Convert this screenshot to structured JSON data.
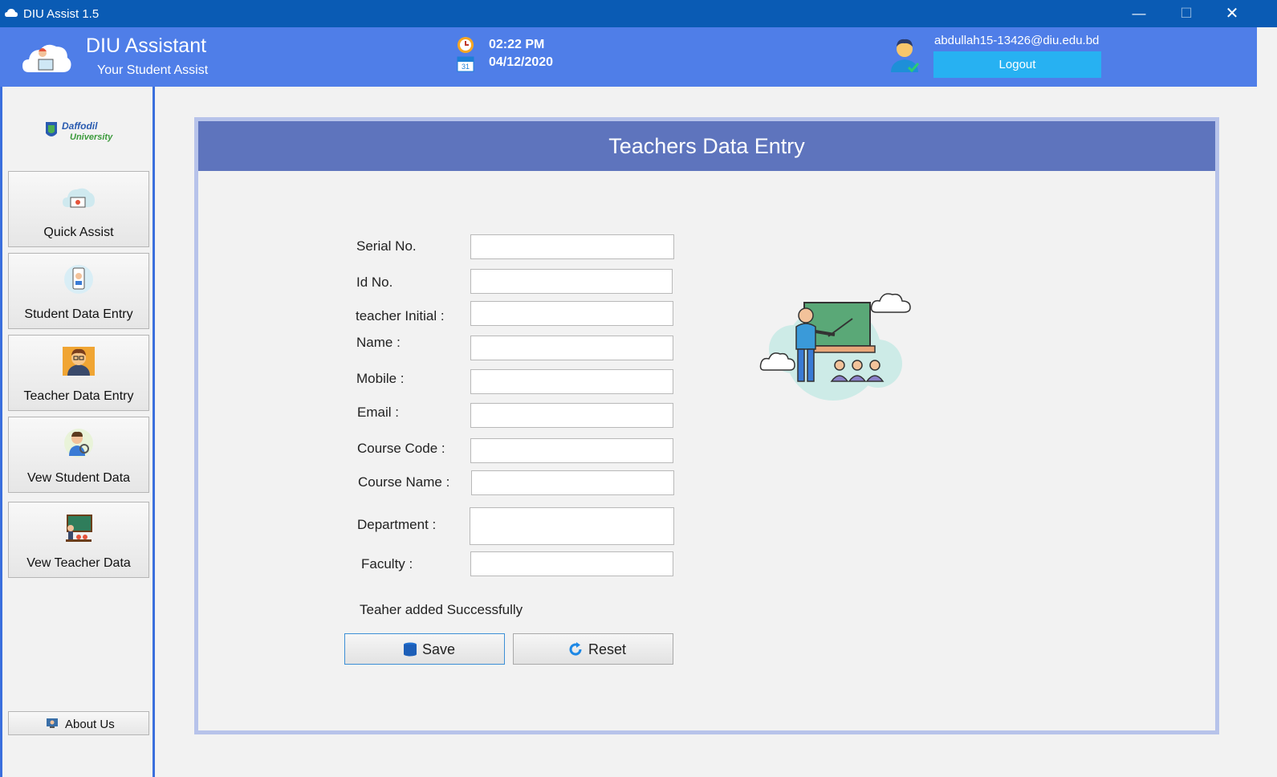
{
  "window": {
    "title": "DIU Assist 1.5",
    "minimize": "—",
    "maximize": "☐",
    "close": "✕"
  },
  "header": {
    "app_name": "DIU Assistant",
    "tagline": "Your Student Assist",
    "time": "02:22 PM",
    "date": "04/12/2020",
    "user_email": "abdullah15-13426@diu.edu.bd",
    "logout_label": "Logout"
  },
  "sidebar": {
    "logo_text": "Daffodil University",
    "items": [
      {
        "label": "Quick Assist",
        "icon": "quick-assist-icon"
      },
      {
        "label": "Student Data Entry",
        "icon": "student-id-icon"
      },
      {
        "label": "Teacher Data Entry",
        "icon": "teacher-avatar-icon"
      },
      {
        "label": "Vew Student Data",
        "icon": "student-search-icon"
      },
      {
        "label": "Vew Teacher Data",
        "icon": "classroom-icon"
      }
    ],
    "about_label": "About Us"
  },
  "form": {
    "title": "Teachers Data Entry",
    "fields": [
      {
        "label": "Serial No.",
        "value": ""
      },
      {
        "label": "Id No.",
        "value": ""
      },
      {
        "label": "teacher Initial :",
        "value": ""
      },
      {
        "label": "Name :",
        "value": ""
      },
      {
        "label": "Mobile :",
        "value": ""
      },
      {
        "label": "Email :",
        "value": ""
      },
      {
        "label": "Course Code :",
        "value": ""
      },
      {
        "label": "Course Name :",
        "value": ""
      },
      {
        "label": "Department :",
        "value": ""
      },
      {
        "label": "Faculty :",
        "value": ""
      }
    ],
    "status_message": "Teaher added Successfully",
    "save_label": "Save",
    "reset_label": "Reset"
  },
  "colors": {
    "titlebar": "#0a5bb4",
    "header": "#4f7ee8",
    "logout": "#27b1f2",
    "panel_header": "#5e74bd",
    "panel_border": "#b7c3ea"
  }
}
